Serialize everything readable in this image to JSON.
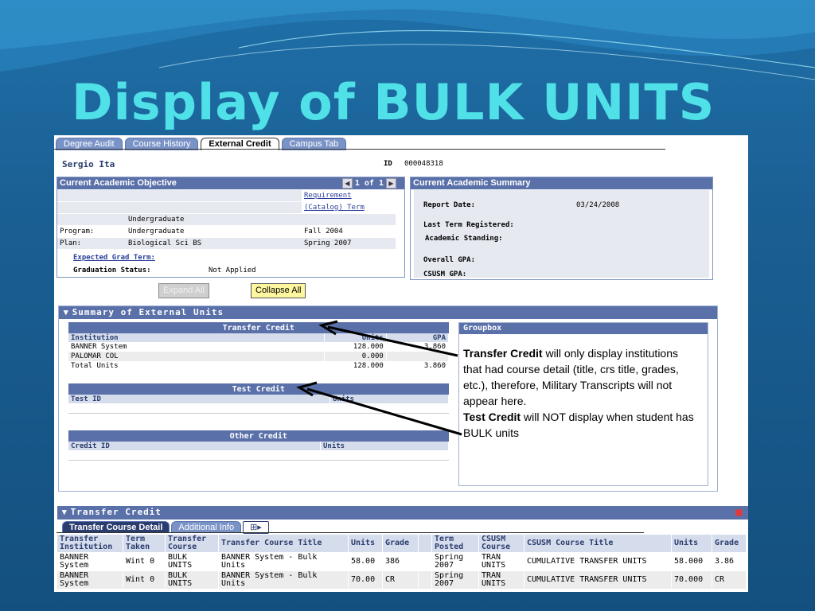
{
  "slide": {
    "title": "Display of BULK UNITS"
  },
  "tabs": [
    "Degree Audit",
    "Course History",
    "External Credit",
    "Campus Tab"
  ],
  "student": {
    "name": "Sergio Ita",
    "id_label": "ID",
    "id": "000048318"
  },
  "objective": {
    "title": "Current Academic Objective",
    "pager": "1 of 1",
    "req_term_1": "Requirement",
    "req_term_2": "(Catalog) Term",
    "career": "Undergraduate",
    "program_label": "Program:",
    "program": "Undergraduate",
    "program_term": "Fall 2004",
    "plan_label": "Plan:",
    "plan": "Biological Sci BS",
    "plan_term": "Spring 2007",
    "grad_term_label": "Expected Grad Term:",
    "grad_status_label": "Graduation Status:",
    "grad_status": "Not Applied"
  },
  "summary": {
    "title": "Current Academic Summary",
    "report_date_label": "Report Date:",
    "report_date": "03/24/2008",
    "last_term_label": "Last Term Registered:",
    "standing_label": "Academic Standing:",
    "overall_gpa_label": "Overall GPA:",
    "csusm_gpa_label": "CSUSM GPA:"
  },
  "buttons": {
    "expand": "Expand All",
    "collapse": "Collapse All"
  },
  "ext_units": {
    "title": "Summary of External Units",
    "transfer": {
      "title": "Transfer Credit",
      "cols": [
        "Institution",
        "Units",
        "GPA"
      ],
      "rows": [
        [
          "BANNER System",
          "128.000",
          "3.860"
        ],
        [
          "PALOMAR COL",
          "0.000",
          ""
        ],
        [
          "Total Units",
          "128.000",
          "3.860"
        ]
      ]
    },
    "test": {
      "title": "Test Credit",
      "cols": [
        "Test ID",
        "Units"
      ]
    },
    "other": {
      "title": "Other Credit",
      "cols": [
        "Credit ID",
        "Units"
      ]
    },
    "groupbox": {
      "title": "Groupbox",
      "p1_bold": "Transfer Credit",
      "p1": " will only display institutions that had course detail (title, crs title, grades, etc.), therefore, Military Transcripts will not appear here.",
      "p2_bold": "Test Credit",
      "p2": " will NOT display when student has BULK units"
    }
  },
  "transfer_credit": {
    "title": "Transfer Credit",
    "tabs": [
      "Transfer Course Detail",
      "Additional Info"
    ],
    "cols": [
      "Transfer Institution",
      "Term Taken",
      "Transfer Course",
      "Transfer Course Title",
      "Units",
      "Grade",
      "",
      "Term Posted",
      "CSUSM Course",
      "CSUSM Course Title",
      "Units",
      "Grade"
    ],
    "rows": [
      [
        "BANNER System",
        "Wint 0",
        "BULK UNITS",
        "BANNER System - Bulk Units",
        "58.00",
        "386",
        "",
        "Spring 2007",
        "TRAN UNITS",
        "CUMULATIVE TRANSFER UNITS",
        "58.000",
        "3.86"
      ],
      [
        "BANNER System",
        "Wint 0",
        "BULK UNITS",
        "BANNER System - Bulk Units",
        "70.00",
        "CR",
        "",
        "Spring 2007",
        "TRAN UNITS",
        "CUMULATIVE TRANSFER UNITS",
        "70.000",
        "CR"
      ]
    ]
  },
  "colors": {
    "accent": "#5a70a8",
    "title": "#4fe0e8",
    "highlight": "#fff7a0"
  }
}
